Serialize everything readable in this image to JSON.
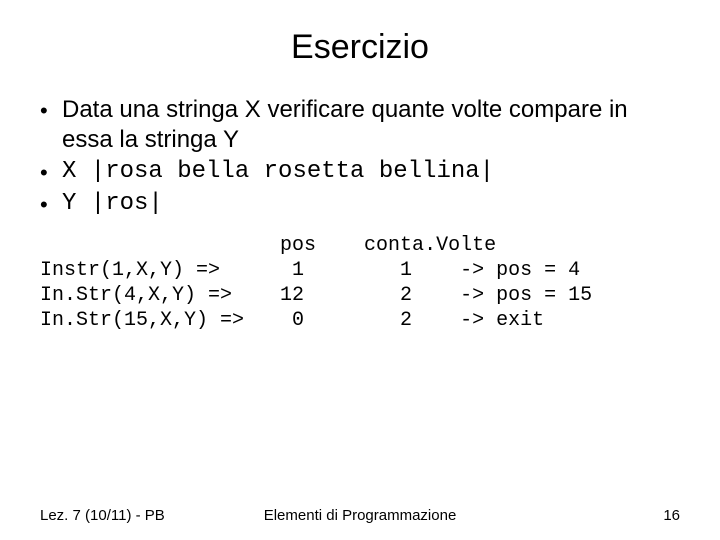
{
  "title": "Esercizio",
  "bullets": {
    "b1": "Data una stringa X verificare quante volte compare in essa la stringa Y",
    "b2_code": "X  |rosa bella rosetta bellina|",
    "b3_code": "Y  |ros|"
  },
  "trace": "                    pos    conta.Volte\nInstr(1,X,Y) =>      1        1    -> pos = 4\nIn.Str(4,X,Y) =>    12        2    -> pos = 15\nIn.Str(15,X,Y) =>    0        2    -> exit",
  "footer": {
    "left": "Lez. 7 (10/11) - PB",
    "center": "Elementi di Programmazione",
    "right": "16"
  }
}
